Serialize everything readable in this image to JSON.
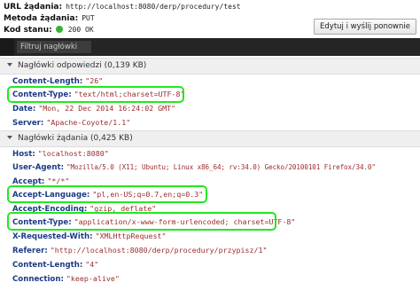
{
  "summary": {
    "url_label": "URL żądania:",
    "url_value": "http://localhost:8080/derp/procedury/test",
    "method_label": "Metoda żądania:",
    "method_value": "PUT",
    "status_label": "Kod stanu:",
    "status_value": "200 OK",
    "status_color": "#3ab03a",
    "edit_button": "Edytuj i wyślij ponownie"
  },
  "filter": {
    "placeholder": "Filtruj nagłówki"
  },
  "response_headers": {
    "title": "Nagłówki odpowiedzi (0,139 KB)",
    "items": [
      {
        "name": "Content-Length:",
        "value": "\"26\""
      },
      {
        "name": "Content-Type:",
        "value": "\"text/html;charset=UTF-8\""
      },
      {
        "name": "Date:",
        "value": "\"Mon, 22 Dec 2014 16:24:02 GMT\""
      },
      {
        "name": "Server:",
        "value": "\"Apache-Coyote/1.1\""
      }
    ]
  },
  "request_headers": {
    "title": "Nagłówki żądania (0,425 KB)",
    "items": [
      {
        "name": "Host:",
        "value": "\"localhost:8080\""
      },
      {
        "name": "User-Agent:",
        "value": "\"Mozilla/5.0 (X11; Ubuntu; Linux x86_64; rv:34.0) Gecko/20100101 Firefox/34.0\""
      },
      {
        "name": "Accept:",
        "value": "\"*/*\""
      },
      {
        "name": "Accept-Language:",
        "value": "\"pl,en-US;q=0.7,en;q=0.3\""
      },
      {
        "name": "Accept-Encoding:",
        "value": "\"gzip, deflate\""
      },
      {
        "name": "Content-Type:",
        "value": "\"application/x-www-form-urlencoded; charset=UTF-8\""
      },
      {
        "name": "X-Requested-With:",
        "value": "\"XMLHttpRequest\""
      },
      {
        "name": "Referer:",
        "value": "\"http://localhost:8080/derp/procedury/przypisz/1\""
      },
      {
        "name": "Content-Length:",
        "value": "\"4\""
      },
      {
        "name": "Connection:",
        "value": "\"keep-alive\""
      }
    ]
  },
  "highlight_color": "#22e81e"
}
